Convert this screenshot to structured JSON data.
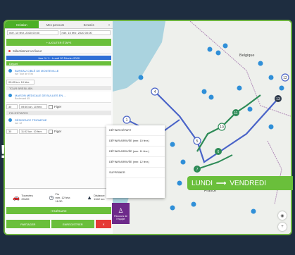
{
  "tabs": [
    "Création",
    "Mes parcours",
    "Ecrasés",
    "×"
  ],
  "dates": [
    "mer. 10 févr. 2020 00:00",
    "mer. 10 févr. 2020 00:00"
  ],
  "panel": {
    "add_button": "+ AJOUTER ÉTAPE",
    "select_label": "Sélectionnez un fixeur",
    "blue_bar": "Jour 1 / 1 - Lundi 10 Février 2020",
    "section_depart": "Départ",
    "stop1_name": "BUREAU CIBLÉ DE MONTEVILLE",
    "stop1_sub": "rue Tour de l'Est",
    "stop1_time": "09:45 lun. 10 févr.",
    "section_tour": "TOUR BRÉSILIEN",
    "stop2_name": "MAISON MÉDICALE DE BULLIES EN ...",
    "stop2_sub": "Boulevard 45",
    "stop2_duration": "30",
    "stop2_time": "09:50 lun. 10 févr.",
    "stop2_fixed": "Figer",
    "section_fin": "FIN D'ÉTAPES",
    "stop3_name": "RÉSIDENCE TRIOMPHE",
    "stop3_sub": "rue 12",
    "stop3_duration": "30",
    "stop3_time": "11:02 lun. 10 févr.",
    "stop3_fixed": "Figer"
  },
  "summary": {
    "tours_label": "Tournées",
    "tours_value": "29h59",
    "date_label": "Fin",
    "date_value": "mer. 12 févr.",
    "date_time": "16:30",
    "distance_label": "Distance",
    "distance_value": "1342 km"
  },
  "buttons": {
    "itinerary": "ITINÉRAIRE",
    "save": "ENREGISTRER",
    "share": "PARTAGER",
    "delete": "✕"
  },
  "popup": [
    "DÉFINIR DÉPART",
    "DÉFINIR ARRIVÉE (mer. 10 févr.)",
    "DÉFINIR ARRIVÉE (mer. 11 févr.)",
    "DÉFINIR ARRIVÉE (mer. 12 févr.)",
    "SUPPRIMER"
  ],
  "map": {
    "city_belgique": "Belgique",
    "city_france": "France",
    "banner_from": "LUNDI",
    "banner_to": "VENDREDI",
    "badge_label": "Parcours de l'équipe"
  },
  "colors": {
    "green": "#6abf3b",
    "blue": "#2f6fd6",
    "route_blue": "#4a64c8",
    "route_green": "#2e8b57",
    "pin_blue": "#2f8fd8",
    "dark_bg": "#1e2d40"
  }
}
